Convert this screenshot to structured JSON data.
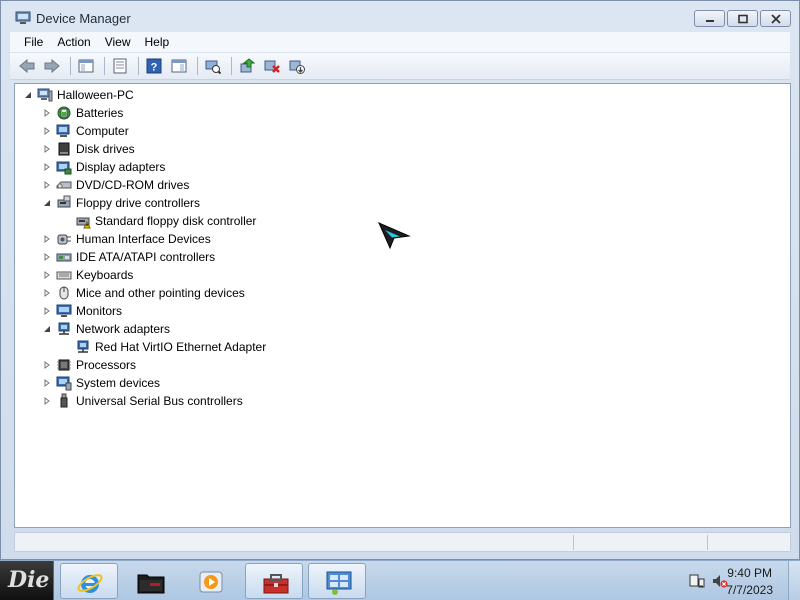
{
  "window": {
    "title": "Device Manager"
  },
  "menu": [
    "File",
    "Action",
    "View",
    "Help"
  ],
  "toolbar": {
    "buttons": [
      "back-icon",
      "forward-icon",
      "show-hide-console-tree-icon",
      "properties-icon",
      "help-icon",
      "action-pane-icon",
      "scan-hardware-icon",
      "update-driver-icon",
      "uninstall-icon",
      "disable-icon"
    ]
  },
  "tree": {
    "root": "Halloween-PC",
    "items": [
      {
        "label": "Batteries",
        "expanded": false,
        "icon": "battery-icon"
      },
      {
        "label": "Computer",
        "expanded": false,
        "icon": "computer-icon"
      },
      {
        "label": "Disk drives",
        "expanded": false,
        "icon": "disk-drive-icon"
      },
      {
        "label": "Display adapters",
        "expanded": false,
        "icon": "display-adapter-icon"
      },
      {
        "label": "DVD/CD-ROM drives",
        "expanded": false,
        "icon": "dvd-drive-icon"
      },
      {
        "label": "Floppy drive controllers",
        "expanded": true,
        "icon": "floppy-controller-icon",
        "children": [
          {
            "label": "Standard floppy disk controller",
            "icon": "floppy-controller-warning-icon",
            "warning": true
          }
        ]
      },
      {
        "label": "Human Interface Devices",
        "expanded": false,
        "icon": "hid-icon"
      },
      {
        "label": "IDE ATA/ATAPI controllers",
        "expanded": false,
        "icon": "ide-controller-icon"
      },
      {
        "label": "Keyboards",
        "expanded": false,
        "icon": "keyboard-icon"
      },
      {
        "label": "Mice and other pointing devices",
        "expanded": false,
        "icon": "mouse-icon"
      },
      {
        "label": "Monitors",
        "expanded": false,
        "icon": "monitor-icon"
      },
      {
        "label": "Network adapters",
        "expanded": true,
        "icon": "network-adapter-icon",
        "children": [
          {
            "label": "Red Hat VirtIO Ethernet Adapter",
            "icon": "network-adapter-icon"
          }
        ]
      },
      {
        "label": "Processors",
        "expanded": false,
        "icon": "processor-icon"
      },
      {
        "label": "System devices",
        "expanded": false,
        "icon": "system-devices-icon"
      },
      {
        "label": "Universal Serial Bus controllers",
        "expanded": false,
        "icon": "usb-icon"
      }
    ]
  },
  "taskbar": {
    "start_label": "Die",
    "buttons": [
      {
        "name": "internet-explorer",
        "active": true
      },
      {
        "name": "folder",
        "active": false
      },
      {
        "name": "media-player",
        "active": false
      },
      {
        "name": "toolbox",
        "active": true
      },
      {
        "name": "control-panel",
        "active": true
      }
    ],
    "clock": {
      "time": "9:40 PM",
      "date": "7/7/2023"
    }
  },
  "colors": {
    "accent": "#3a6fb0",
    "warning": "#f2c200",
    "window_frame": "#dce6f2"
  }
}
